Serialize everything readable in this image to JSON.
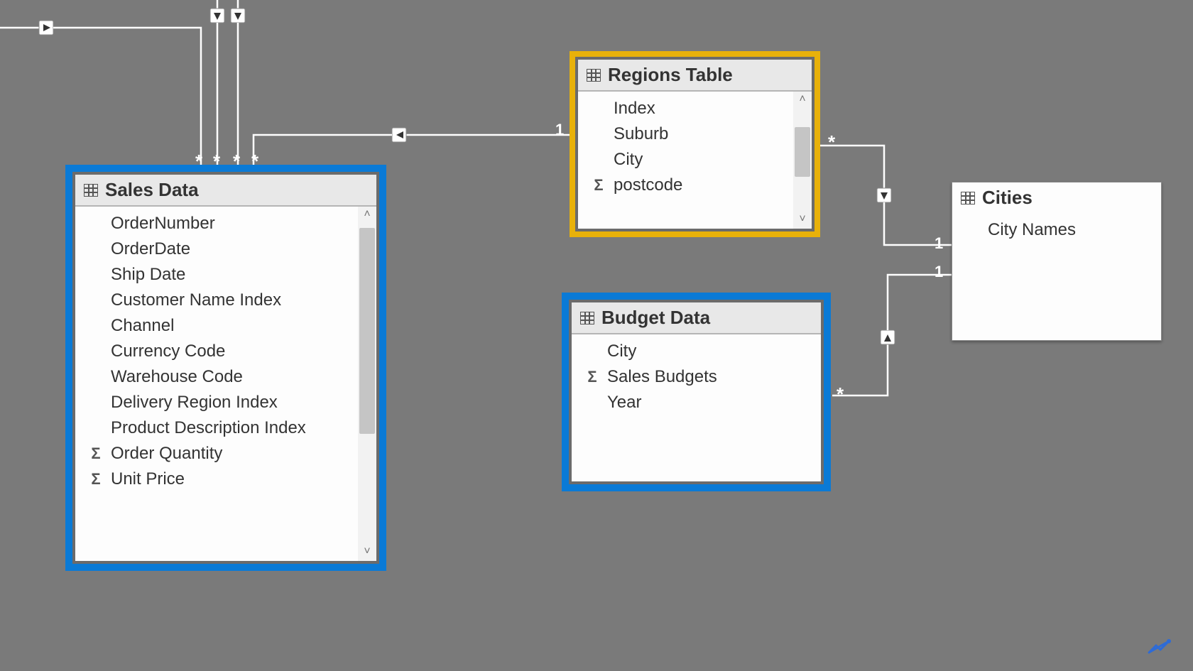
{
  "tables": {
    "sales": {
      "title": "Sales Data",
      "fields": [
        {
          "label": "OrderNumber",
          "sigma": false
        },
        {
          "label": "OrderDate",
          "sigma": false
        },
        {
          "label": "Ship Date",
          "sigma": false
        },
        {
          "label": "Customer Name Index",
          "sigma": false
        },
        {
          "label": "Channel",
          "sigma": false
        },
        {
          "label": "Currency Code",
          "sigma": false
        },
        {
          "label": "Warehouse Code",
          "sigma": false
        },
        {
          "label": "Delivery Region Index",
          "sigma": false
        },
        {
          "label": "Product Description Index",
          "sigma": false
        },
        {
          "label": "Order Quantity",
          "sigma": true
        },
        {
          "label": "Unit Price",
          "sigma": true
        }
      ]
    },
    "regions": {
      "title": "Regions Table",
      "fields": [
        {
          "label": "Index",
          "sigma": false
        },
        {
          "label": "Suburb",
          "sigma": false
        },
        {
          "label": "City",
          "sigma": false
        },
        {
          "label": "postcode",
          "sigma": true
        }
      ]
    },
    "budget": {
      "title": "Budget Data",
      "fields": [
        {
          "label": "City",
          "sigma": false
        },
        {
          "label": "Sales Budgets",
          "sigma": true
        },
        {
          "label": "Year",
          "sigma": false
        }
      ]
    },
    "cities": {
      "title": "Cities",
      "fields": [
        {
          "label": "City Names",
          "sigma": false
        }
      ]
    }
  },
  "cardinality": {
    "one_a": "1",
    "one_b": "1",
    "one_c": "1",
    "star_a": "*",
    "star_b": "*",
    "star_in1": "*",
    "star_in2": "*",
    "star_in3": "*",
    "star_in4": "*"
  }
}
